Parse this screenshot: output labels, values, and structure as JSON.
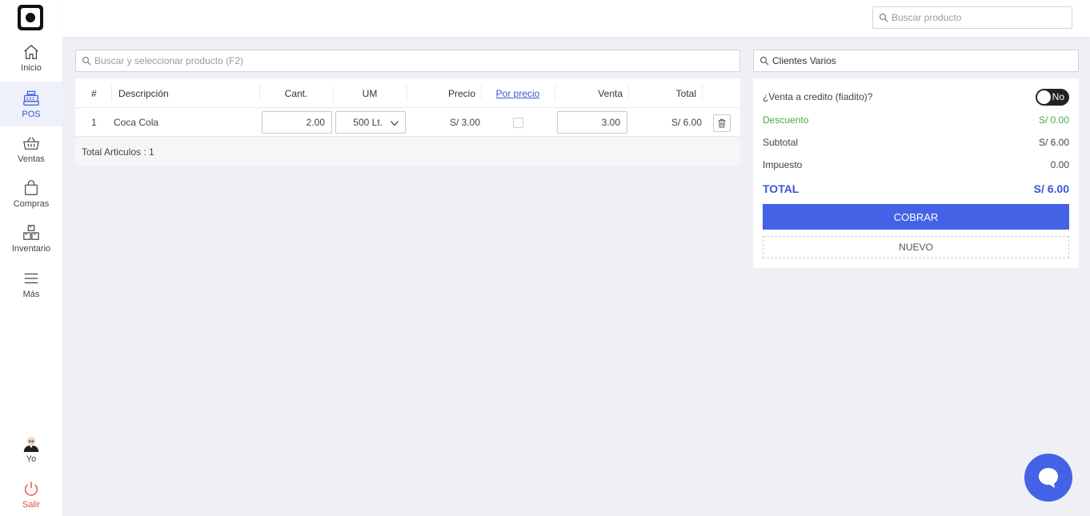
{
  "sidebar": {
    "items": [
      {
        "label": "Inicio",
        "icon": "home-icon"
      },
      {
        "label": "POS",
        "icon": "cash-register-icon"
      },
      {
        "label": "Ventas",
        "icon": "basket-icon"
      },
      {
        "label": "Compras",
        "icon": "shopping-bag-icon"
      },
      {
        "label": "Inventario",
        "icon": "boxes-icon"
      },
      {
        "label": "Más",
        "icon": "menu-icon"
      }
    ],
    "user_label": "Yo",
    "logout_label": "Salir"
  },
  "topbar": {
    "search_placeholder": "Buscar producto"
  },
  "pos": {
    "search_placeholder": "Buscar y seleccionar producto (F2)",
    "table": {
      "headers": {
        "num": "#",
        "descripcion": "Descripción",
        "cant": "Cant.",
        "um": "UM",
        "precio": "Precio",
        "por_precio": "Por precio",
        "venta": "Venta",
        "total": "Total"
      },
      "rows": [
        {
          "num": "1",
          "descripcion": "Coca Cola",
          "cant": "2.00",
          "um": "500 Lt.",
          "precio": "S/ 3.00",
          "por_precio": false,
          "venta": "3.00",
          "total": "S/ 6.00"
        }
      ],
      "footer": "Total Articulos : 1"
    }
  },
  "client": {
    "value": "Clientes Varios"
  },
  "summary": {
    "credit_label": "¿Venta a credito (fiadito)?",
    "credit_toggle": "No",
    "descuento_label": "Descuento",
    "descuento_value": "S/ 0.00",
    "subtotal_label": "Subtotal",
    "subtotal_value": "S/ 6.00",
    "impuesto_label": "Impuesto",
    "impuesto_value": "0.00",
    "total_label": "TOTAL",
    "total_value": "S/ 6.00",
    "cobrar_label": "COBRAR",
    "nuevo_label": "NUEVO"
  },
  "colors": {
    "accent": "#4462e6",
    "discount_green": "#4aa84a",
    "logout_red": "#e24b4b",
    "background": "#eff0f5"
  }
}
